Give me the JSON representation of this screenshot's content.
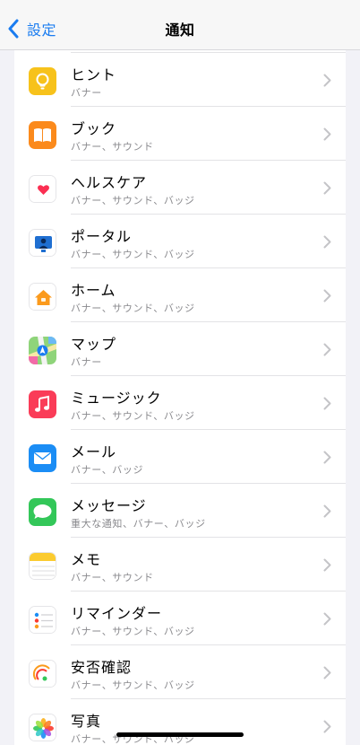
{
  "nav": {
    "back_label": "設定",
    "title": "通知"
  },
  "rows": [
    {
      "title": "ヒント",
      "subtitle": "バナー",
      "icon": "tips-icon"
    },
    {
      "title": "ブック",
      "subtitle": "バナー、サウンド",
      "icon": "books-icon"
    },
    {
      "title": "ヘルスケア",
      "subtitle": "バナー、サウンド、バッジ",
      "icon": "health-icon"
    },
    {
      "title": "ポータル",
      "subtitle": "バナー、サウンド、バッジ",
      "icon": "portal-icon"
    },
    {
      "title": "ホーム",
      "subtitle": "バナー、サウンド、バッジ",
      "icon": "home-icon"
    },
    {
      "title": "マップ",
      "subtitle": "バナー",
      "icon": "maps-icon"
    },
    {
      "title": "ミュージック",
      "subtitle": "バナー、サウンド、バッジ",
      "icon": "music-icon"
    },
    {
      "title": "メール",
      "subtitle": "バナー、バッジ",
      "icon": "mail-icon"
    },
    {
      "title": "メッセージ",
      "subtitle": "重大な通知、バナー、バッジ",
      "icon": "messages-icon"
    },
    {
      "title": "メモ",
      "subtitle": "バナー、サウンド",
      "icon": "notes-icon"
    },
    {
      "title": "リマインダー",
      "subtitle": "バナー、サウンド、バッジ",
      "icon": "reminders-icon"
    },
    {
      "title": "安否確認",
      "subtitle": "バナー、サウンド、バッジ",
      "icon": "safety-check-icon"
    },
    {
      "title": "写真",
      "subtitle": "バナー、サウンド、バッジ",
      "icon": "photos-icon"
    }
  ],
  "colors": {
    "accent": "#1a7cf0",
    "background": "#f2f2f7",
    "row_background": "#ffffff",
    "subtitle": "#8a8a8e"
  }
}
